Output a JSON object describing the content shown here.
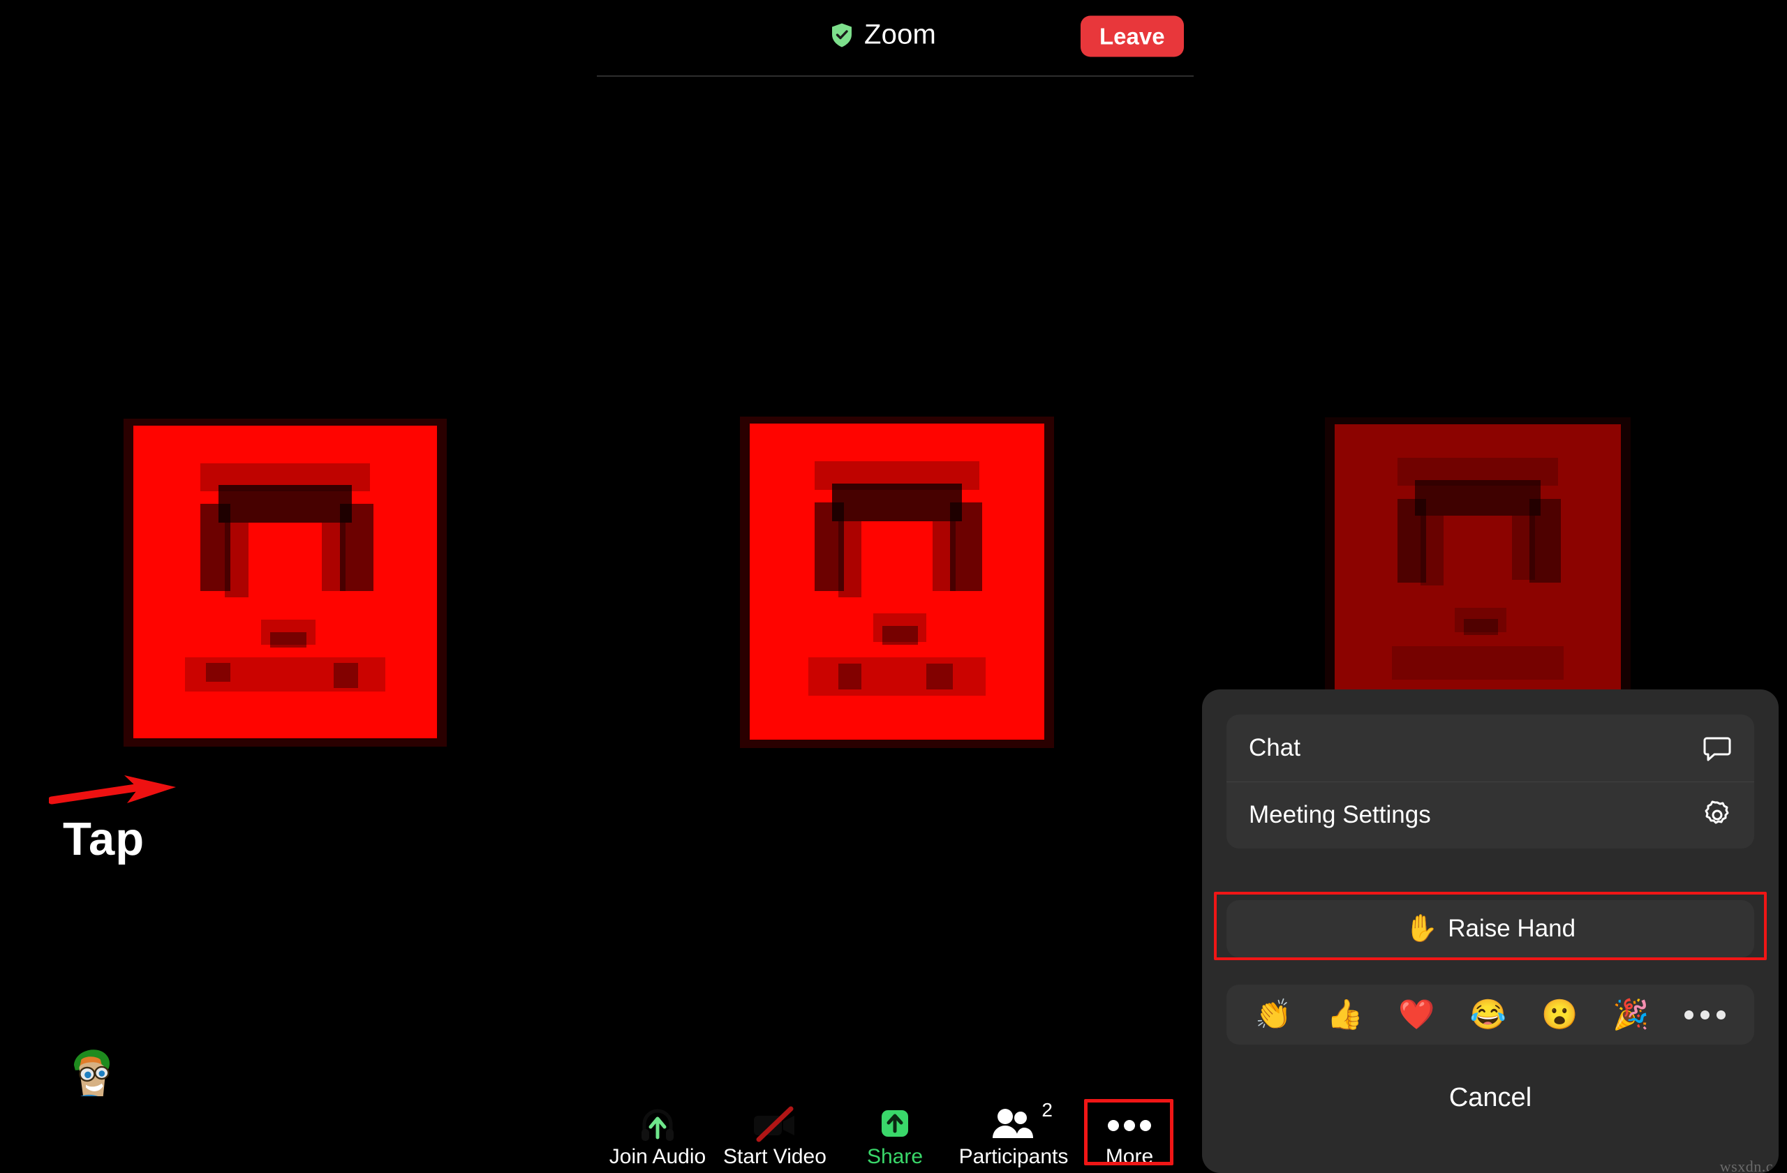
{
  "header": {
    "title": "Zoom",
    "shield_icon": "verified-shield-icon",
    "leave_label": "Leave"
  },
  "annotation": {
    "label": "Tap",
    "arrow_icon": "red-arrow-right-icon"
  },
  "stage": {
    "avatar_icon": "cartoon-avatar-green-hat",
    "page_dots": [
      "inactive",
      "active",
      "inactive"
    ],
    "tiles": [
      {
        "name": "participant-video-tile-1",
        "state": "bright"
      },
      {
        "name": "participant-video-tile-2",
        "state": "bright"
      },
      {
        "name": "participant-video-tile-3",
        "state": "dimmed"
      }
    ]
  },
  "toolbar": {
    "items": [
      {
        "label": "Join Audio",
        "icon": "headphones-up-arrow-icon",
        "label_color": "#ffffff"
      },
      {
        "label": "Start Video",
        "icon": "video-camera-off-icon",
        "label_color": "#ffffff"
      },
      {
        "label": "Share",
        "icon": "share-up-arrow-icon",
        "label_color": "#3ad76a"
      },
      {
        "label": "Participants",
        "icon": "participants-icon",
        "label_color": "#ffffff",
        "badge": "2"
      },
      {
        "label": "More",
        "icon": "ellipsis-horizontal-icon",
        "label_color": "#ffffff",
        "highlighted": true
      }
    ]
  },
  "more_panel": {
    "rows": [
      {
        "label": "Chat",
        "icon": "chat-bubble-icon"
      },
      {
        "label": "Meeting Settings",
        "icon": "gear-icon"
      }
    ],
    "raise_hand": {
      "label": "Raise Hand",
      "emoji": "✋",
      "highlighted": true
    },
    "reactions": [
      {
        "name": "clapping-hands-emoji",
        "glyph": "👏"
      },
      {
        "name": "thumbs-up-emoji",
        "glyph": "👍"
      },
      {
        "name": "red-heart-emoji",
        "glyph": "❤️"
      },
      {
        "name": "tears-of-joy-emoji",
        "glyph": "😂"
      },
      {
        "name": "open-mouth-emoji",
        "glyph": "😮"
      },
      {
        "name": "party-popper-emoji",
        "glyph": "🎉"
      }
    ],
    "reactions_more_icon": "ellipsis-horizontal-icon",
    "cancel_label": "Cancel"
  },
  "watermark": "wsxdn.c",
  "colors": {
    "accent_red": "#e8373b",
    "highlight_red": "#f01616",
    "accent_green": "#3ad76a",
    "panel_bg": "#2b2b2b",
    "card_bg": "#333333",
    "page_bg": "#000000"
  }
}
